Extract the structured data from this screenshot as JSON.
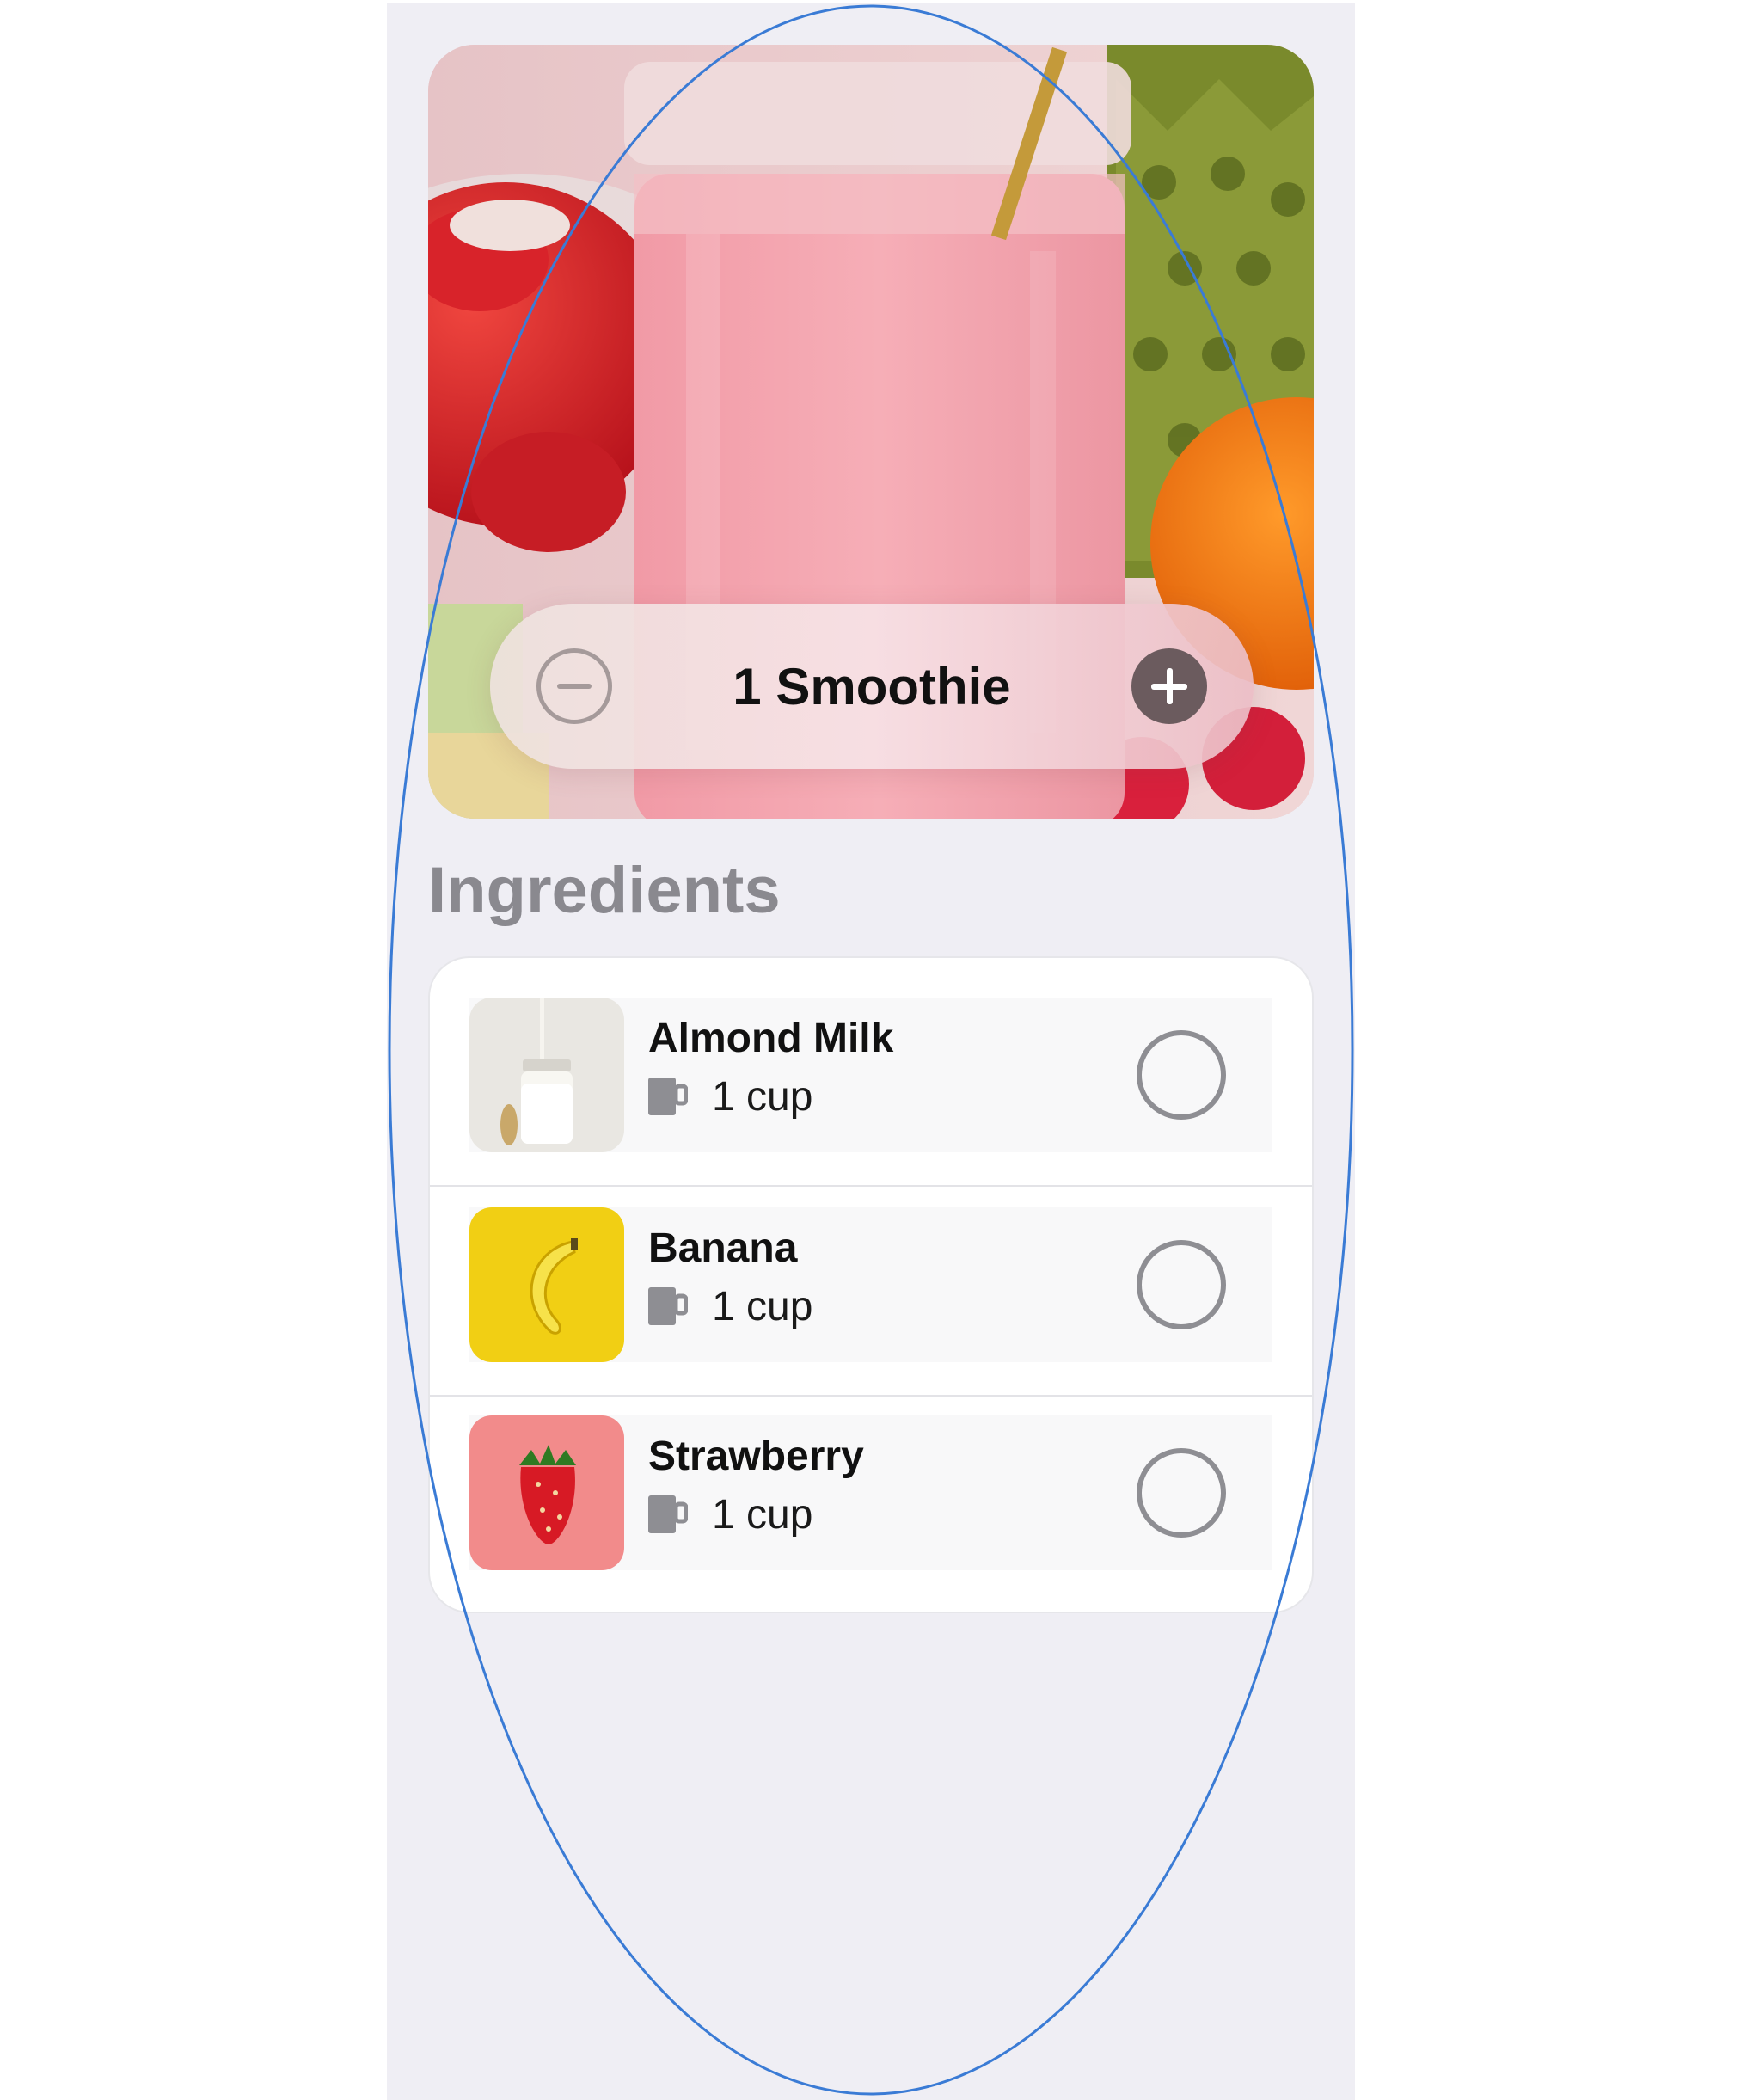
{
  "hero": {
    "counter_label": "1 Smoothie",
    "decrement_icon": "minus-circle-icon",
    "increment_icon": "plus-circle-icon"
  },
  "section_title": "Ingredients",
  "ingredients": [
    {
      "name": "Almond Milk",
      "quantity": "1 cup",
      "icon": "cup-icon",
      "checked": false
    },
    {
      "name": "Banana",
      "quantity": "1 cup",
      "icon": "cup-icon",
      "checked": false
    },
    {
      "name": "Strawberry",
      "quantity": "1 cup",
      "icon": "cup-icon",
      "checked": false
    }
  ],
  "colors": {
    "background": "#efeef4",
    "section_title": "#8a898f",
    "increment_button": "#6b5b5e",
    "checkbox_border": "#8e8e93"
  }
}
